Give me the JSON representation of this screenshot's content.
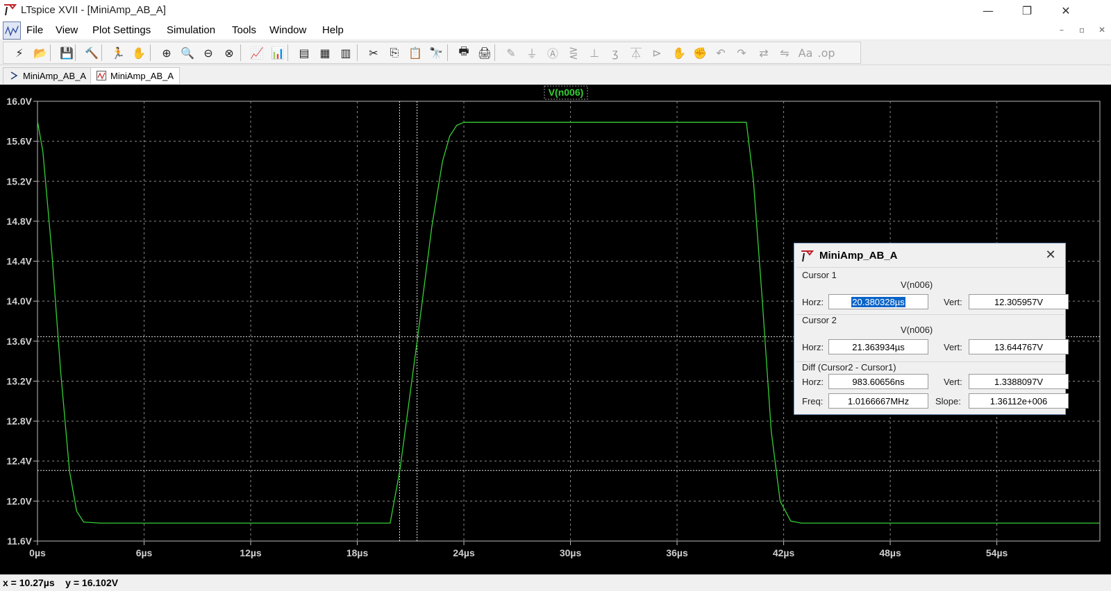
{
  "window": {
    "title": "LTspice XVII - [MiniAmp_AB_A]",
    "controls": {
      "minimize": "—",
      "restore": "❐",
      "close": "✕"
    }
  },
  "menubar": {
    "items": [
      "File",
      "View",
      "Plot Settings",
      "Simulation",
      "Tools",
      "Window",
      "Help"
    ],
    "mdi_controls": {
      "minimize": "–",
      "restore": "▫",
      "close": "✕"
    }
  },
  "toolbar": {
    "buttons": [
      {
        "name": "open-schematic-icon",
        "glyph": "⚡"
      },
      {
        "name": "open-folder-icon",
        "glyph": "📂"
      },
      {
        "name": "save-icon",
        "glyph": "💾"
      },
      {
        "name": "control-panel-icon",
        "glyph": "🔨"
      },
      {
        "name": "run-icon",
        "glyph": "🏃"
      },
      {
        "name": "halt-icon",
        "glyph": "✋"
      },
      {
        "name": "zoom-area-icon",
        "glyph": "⊕"
      },
      {
        "name": "pan-icon",
        "glyph": "🔍"
      },
      {
        "name": "zoom-out-icon",
        "glyph": "⊖"
      },
      {
        "name": "zoom-full-icon",
        "glyph": "⊗"
      },
      {
        "name": "autorange-icon",
        "glyph": "📈"
      },
      {
        "name": "add-traces-icon",
        "glyph": "📊"
      },
      {
        "name": "tile-horizontal-icon",
        "glyph": "▤"
      },
      {
        "name": "cascade-icon",
        "glyph": "▦"
      },
      {
        "name": "tile-vertical-icon",
        "glyph": "▥"
      },
      {
        "name": "cut-icon",
        "glyph": "✂"
      },
      {
        "name": "copy-icon",
        "glyph": "⎘"
      },
      {
        "name": "paste-icon",
        "glyph": "📋"
      },
      {
        "name": "find-icon",
        "glyph": "🔭"
      },
      {
        "name": "print-icon",
        "glyph": "🖶"
      },
      {
        "name": "print-preview-icon",
        "glyph": "🖨"
      },
      {
        "name": "draw-wire-icon",
        "glyph": "✎"
      },
      {
        "name": "ground-icon",
        "glyph": "⏚"
      },
      {
        "name": "label-net-icon",
        "glyph": "Ⓐ"
      },
      {
        "name": "resistor-icon",
        "glyph": "⋛"
      },
      {
        "name": "capacitor-icon",
        "glyph": "⊥"
      },
      {
        "name": "inductor-icon",
        "glyph": "ʒ"
      },
      {
        "name": "diode-icon",
        "glyph": "⏄"
      },
      {
        "name": "component-icon",
        "glyph": "⊳"
      },
      {
        "name": "move-icon",
        "glyph": "✋"
      },
      {
        "name": "drag-icon",
        "glyph": "✊"
      },
      {
        "name": "undo-icon",
        "glyph": "↶"
      },
      {
        "name": "redo-icon",
        "glyph": "↷"
      },
      {
        "name": "rotate-icon",
        "glyph": "⇄"
      },
      {
        "name": "mirror-icon",
        "glyph": "⇋"
      },
      {
        "name": "text-icon",
        "glyph": "Aa"
      },
      {
        "name": "spice-directive-icon",
        "glyph": ".op"
      }
    ]
  },
  "tabs": [
    {
      "label": "MiniAmp_AB_A",
      "type": "schematic"
    },
    {
      "label": "MiniAmp_AB_A",
      "type": "waveform",
      "active": true
    }
  ],
  "plot": {
    "trace_name": "V(n006)",
    "colors": {
      "background": "#000000",
      "trace": "#35d035",
      "grid": "#8c8c8c",
      "axis_text": "#cfcfcf",
      "trace_label_bg": "#1a6e1a"
    },
    "x_ticks": [
      "0µs",
      "6µs",
      "12µs",
      "18µs",
      "24µs",
      "30µs",
      "36µs",
      "42µs",
      "48µs",
      "54µs"
    ],
    "y_ticks": [
      "16.0V",
      "15.6V",
      "15.2V",
      "14.8V",
      "14.4V",
      "14.0V",
      "13.6V",
      "13.2V",
      "12.8V",
      "12.4V",
      "12.0V",
      "11.6V"
    ]
  },
  "chart_data": {
    "type": "line",
    "title": "V(n006)",
    "xlabel": "",
    "ylabel": "",
    "x_unit": "µs",
    "y_unit": "V",
    "xlim": [
      0,
      59.8
    ],
    "ylim": [
      11.6,
      16.0
    ],
    "grid": true,
    "series": [
      {
        "name": "V(n006)",
        "x": [
          0,
          0.3,
          0.8,
          1.3,
          1.8,
          2.2,
          2.6,
          3.5,
          5,
          10,
          15,
          19.5,
          19.85,
          20.4,
          21.4,
          22.2,
          22.8,
          23.2,
          23.6,
          24,
          26,
          30,
          35,
          39.9,
          40.3,
          40.8,
          41.3,
          41.8,
          42.4,
          43,
          45,
          50,
          55,
          59.8
        ],
        "y": [
          15.8,
          15.5,
          14.5,
          13.3,
          12.3,
          11.9,
          11.79,
          11.78,
          11.78,
          11.78,
          11.78,
          11.78,
          11.78,
          12.31,
          13.64,
          14.75,
          15.4,
          15.65,
          15.76,
          15.79,
          15.79,
          15.79,
          15.79,
          15.79,
          15.2,
          14.0,
          12.7,
          12.0,
          11.8,
          11.78,
          11.78,
          11.78,
          11.78,
          11.78
        ]
      }
    ],
    "cursors": [
      {
        "name": "Cursor 1",
        "x": 20.380328,
        "y": 12.305957
      },
      {
        "name": "Cursor 2",
        "x": 21.363934,
        "y": 13.644767
      }
    ]
  },
  "cursor_dialog": {
    "title": "MiniAmp_AB_A",
    "close_glyph": "✕",
    "cursor1": {
      "label": "Cursor 1",
      "trace": "V(n006)",
      "horz_label": "Horz:",
      "horz": "20.380328µs",
      "vert_label": "Vert:",
      "vert": "12.305957V"
    },
    "cursor2": {
      "label": "Cursor 2",
      "trace": "V(n006)",
      "horz_label": "Horz:",
      "horz": "21.363934µs",
      "vert_label": "Vert:",
      "vert": "13.644767V"
    },
    "diff": {
      "label": "Diff (Cursor2 - Cursor1)",
      "horz_label": "Horz:",
      "horz": "983.60656ns",
      "vert_label": "Vert:",
      "vert": "1.3388097V",
      "freq_label": "Freq:",
      "freq": "1.0166667MHz",
      "slope_label": "Slope:",
      "slope": "1.36112e+006"
    }
  },
  "statusbar": {
    "text": "x = 10.27µs    y = 16.102V"
  }
}
